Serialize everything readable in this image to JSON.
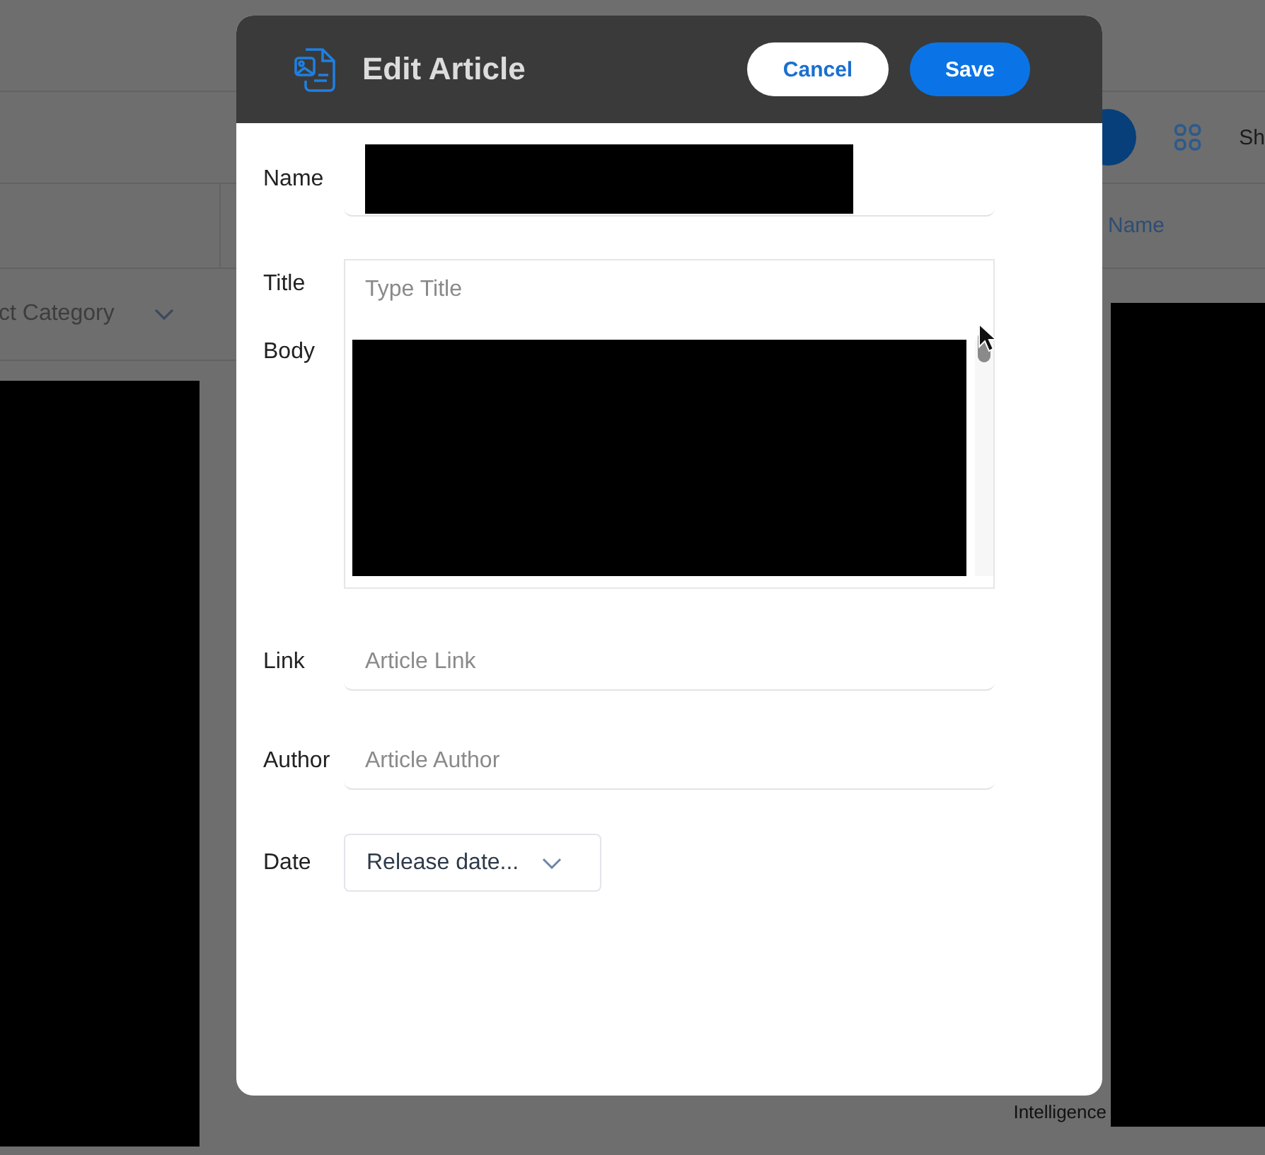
{
  "background": {
    "filter": {
      "value": "ct Category"
    },
    "column_header": "Name",
    "toolbar_text": "Sh",
    "last_cell": "Intelligence"
  },
  "dialog": {
    "title": "Edit Article",
    "buttons": [
      {
        "label": "Cancel",
        "kind": "secondary"
      },
      {
        "label": "Save",
        "kind": "primary"
      }
    ],
    "fields": [
      {
        "kind": "line",
        "label": "Name",
        "redacted": true
      },
      {
        "kind": "editor",
        "label": "Title",
        "placeholder": "Type Title",
        "body_label": "Body",
        "redacted": true
      },
      {
        "kind": "line",
        "label": "Link",
        "placeholder": "Article Link"
      },
      {
        "kind": "line",
        "label": "Author",
        "placeholder": "Article Author"
      },
      {
        "kind": "select",
        "label": "Date",
        "value": "Release date..."
      }
    ]
  }
}
